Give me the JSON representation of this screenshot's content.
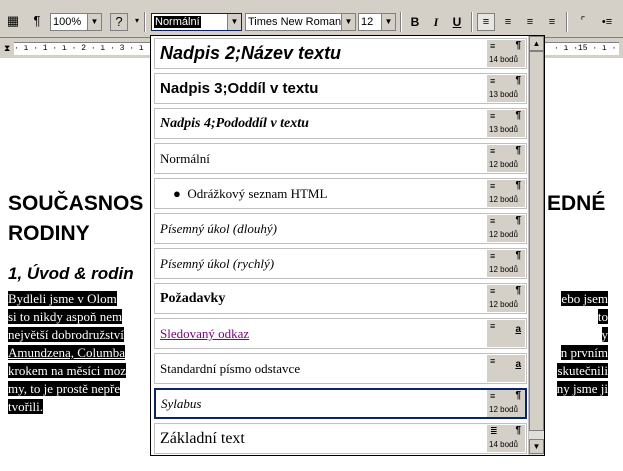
{
  "toolbar": {
    "zoom": "100%",
    "style_value": "Normální",
    "font_value": "Times New Roman",
    "size_value": "12",
    "bold_label": "B",
    "italic_label": "I",
    "underline_label": "U",
    "icons": [
      "document-map-icon",
      "paragraph-mark-icon",
      "help-icon",
      "align-left-icon",
      "align-center-icon",
      "align-right-icon",
      "justify-icon",
      "numbering-icon",
      "bullets-icon"
    ]
  },
  "ruler": {
    "ticks": "· ı · 1 · ı · 2 · ı · 3 · ı",
    "ticks_right": "· ı ·15 · ı ·"
  },
  "document": {
    "title_line1_left": "SOUČASNOS",
    "title_line1_right": "EDNÉ",
    "title_line2": "RODINY",
    "heading_left": "1, Úvod & rodin",
    "body_left_lines": [
      "Bydleli  jsme v  Olom",
      "si to nikdy aspoň nem",
      "největší dobrodružství",
      "Amundzena, Columba",
      "krokem na měsíci moz",
      "my, to  je prostě nepře",
      "tvořili."
    ],
    "body_right_lines": [
      "ebo jsem",
      "to",
      "y",
      "n prvním",
      "skutečnili",
      "ny jsme ji"
    ]
  },
  "dropdown": {
    "items": [
      {
        "label": "Nadpis 2;Název textu",
        "type": "¶",
        "size": "14 bodů"
      },
      {
        "label": "Nadpis 3;Oddíl v textu",
        "type": "¶",
        "size": "13 bodů"
      },
      {
        "label": "Nadpis 4;Pododdíl v textu",
        "type": "¶",
        "size": "13 bodů"
      },
      {
        "label": "Normální",
        "type": "¶",
        "size": "12 bodů"
      },
      {
        "label": "Odrážkový seznam HTML",
        "type": "¶",
        "size": "12 bodů"
      },
      {
        "label": "Písemný úkol (dlouhý)",
        "type": "¶",
        "size": "12 bodů"
      },
      {
        "label": "Písemný úkol (rychlý)",
        "type": "¶",
        "size": "12 bodů"
      },
      {
        "label": "Požadavky",
        "type": "¶",
        "size": "12 bodů"
      },
      {
        "label": "Sledovaný odkaz",
        "type": "a",
        "size": ""
      },
      {
        "label": "Standardní písmo odstavce",
        "type": "a",
        "size": ""
      },
      {
        "label": "Sylabus",
        "type": "¶",
        "size": "12 bodů"
      },
      {
        "label": "Základní text",
        "type": "¶",
        "size": "14 bodů"
      }
    ],
    "link_color": "#800080",
    "active_border": "#0a246a"
  }
}
